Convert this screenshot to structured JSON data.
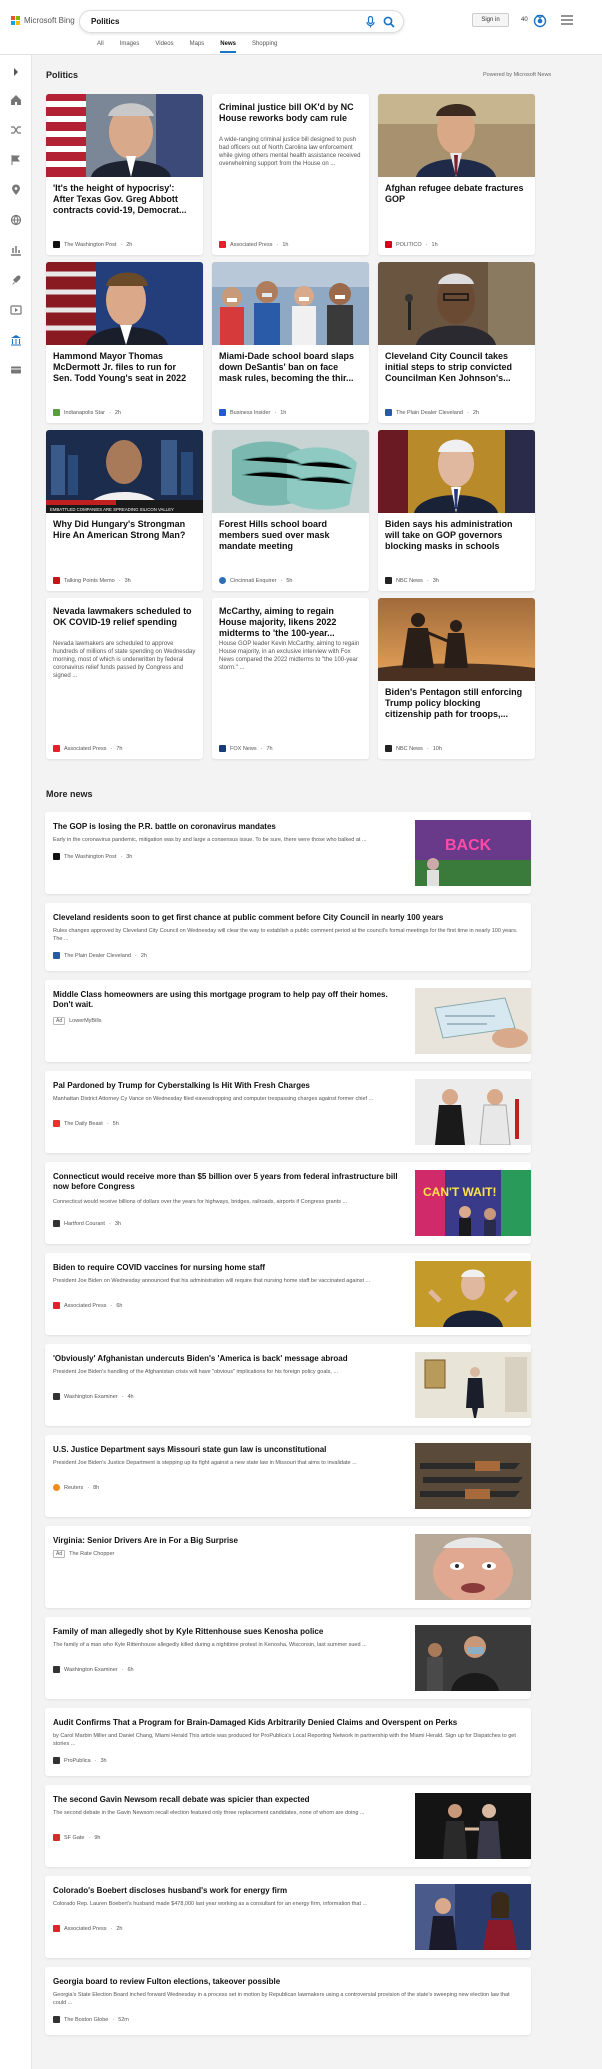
{
  "header": {
    "logo_text": "Microsoft Bing",
    "search_query": "Politics",
    "tabs": [
      "All",
      "Images",
      "Videos",
      "Maps",
      "News",
      "Shopping"
    ],
    "active_tab": "News",
    "signin": "Sign in",
    "points": "40"
  },
  "politics": {
    "title": "Politics",
    "powered": "Powered by Microsoft News",
    "cards": [
      {
        "title": "'It's the height of hypocrisy': After Texas Gov. Greg Abbott contracts covid-19, Democrat...",
        "source": "The Washington Post",
        "time": "2h",
        "logo_color": "#111"
      },
      {
        "title": "Criminal justice bill OK'd by NC House reworks body cam rule",
        "snippet": "A wide-ranging criminal justice bill designed to push bad officers out of North Carolina law enforcement while giving others mental health assistance received overwhelming support from the House on ...",
        "source": "Associated Press",
        "time": "1h",
        "logo_color": "#e4202d"
      },
      {
        "title": "Afghan refugee debate fractures GOP",
        "source": "POLITICO",
        "time": "1h",
        "logo_color": "#d6001c"
      },
      {
        "title": "Hammond Mayor Thomas McDermott Jr. files to run for Sen. Todd Young's seat in 2022",
        "source": "Indianapolis Star",
        "time": "2h",
        "logo_color": "#5a9e3a"
      },
      {
        "title": "Miami-Dade school board slaps down DeSantis' ban on face mask rules, becoming the thir...",
        "source": "Business Insider",
        "time": "1h",
        "logo_color": "#1d5cd6"
      },
      {
        "title": "Cleveland City Council takes initial steps to strip convicted Councilman Ken Johnson's...",
        "source": "The Plain Dealer Cleveland",
        "time": "2h",
        "logo_color": "#2a5aa6"
      },
      {
        "title": "Why Did Hungary's Strongman Hire An American Strong Man?",
        "source": "Talking Points Memo",
        "time": "3h",
        "logo_color": "#c4141b"
      },
      {
        "title": "Forest Hills school board members sued over mask mandate meeting",
        "source": "Cincinnati Enquirer",
        "time": "5h",
        "logo_color": "#2d6fb6"
      },
      {
        "title": "Biden says his administration will take on GOP governors blocking masks in schools",
        "source": "NBC News",
        "time": "3h",
        "logo_color": "#222"
      },
      {
        "title": "Nevada lawmakers scheduled to OK COVID-19 relief spending",
        "snippet": "Nevada lawmakers are scheduled to approve hundreds of millions of state spending on Wednesday morning, most of which is underwritten by federal coronavirus relief funds passed by Congress and signed ...",
        "source": "Associated Press",
        "time": "7h",
        "logo_color": "#e4202d"
      },
      {
        "title": "McCarthy, aiming to regain House majority, likens 2022 midterms to 'the 100-year...",
        "snippet": "House GOP leader Kevin McCarthy, aiming to regain House majority, in an exclusive interview with Fox News compared the 2022 midterms to \"the 100-year storm.\" ...",
        "source": "FOX News",
        "time": "7h",
        "logo_color": "#1a3a7a"
      },
      {
        "title": "Biden's Pentagon still enforcing Trump policy blocking citizenship path for troops,...",
        "source": "NBC News",
        "time": "10h",
        "logo_color": "#222"
      }
    ],
    "caption": "EMBATTLED COMPANIES ARE SPREADING SILICON VALLEY"
  },
  "more_news": {
    "title": "More news",
    "items": [
      {
        "title": "The GOP is losing the P.R. battle on coronavirus mandates",
        "snippet": "Early in the coronavirus pandemic, mitigation was by and large a consensus issue. To be sure, there were those who balked at ...",
        "source": "The Washington Post",
        "time": "3h",
        "logo_color": "#111",
        "img_text": "BACK"
      },
      {
        "title": "Cleveland residents soon to get first chance at public comment before City Council in nearly 100 years",
        "snippet": "Rules changes approved by Cleveland City Council on Wednesday will clear the way to establish a public comment period at the council's formal meetings for the first time in nearly 100 years. The ...",
        "source": "The Plain Dealer Cleveland",
        "time": "2h",
        "logo_color": "#2a5aa6"
      },
      {
        "title": "Middle Class homeowners are using this mortgage program to help pay off their homes. Don't wait.",
        "ad": "Ad",
        "source": "LowerMyBills"
      },
      {
        "title": "Pal Pardoned by Trump for Cyberstalking Is Hit With Fresh Charges",
        "snippet": "Manhattan District Attorney Cy Vance on Wednesday filed eavesdropping and computer trespassing charges against former chief ...",
        "source": "The Daily Beast",
        "time": "5h",
        "logo_color": "#e8322f"
      },
      {
        "title": "Connecticut would receive more than $5 billion over 5 years from federal infrastructure bill now before Congress",
        "snippet": "Connecticut would receive billions of dollars over the years for highways, bridges, railroads, airports if Congress grants ...",
        "source": "Hartford Courant",
        "time": "3h",
        "logo_color": "#333",
        "img_text": "CAN'T WAIT!"
      },
      {
        "title": "Biden to require COVID vaccines for nursing home staff",
        "snippet": "President Joe Biden on Wednesday announced that his administration will require that nursing home staff be vaccinated against ...",
        "source": "Associated Press",
        "time": "6h",
        "logo_color": "#e4202d"
      },
      {
        "title": "'Obviously' Afghanistan undercuts Biden's 'America is back' message abroad",
        "snippet": "President Joe Biden's handling of the Afghanistan crisis will have \"obvious\" implications for his foreign policy goals, ...",
        "source": "Washington Examiner",
        "time": "4h",
        "logo_color": "#333"
      },
      {
        "title": "U.S. Justice Department says Missouri state gun law is unconstitutional",
        "snippet": "President Joe Biden's Justice Department is stepping up its fight against a new state law in Missouri that aims to invalidate ...",
        "source": "Reuters",
        "time": "8h",
        "logo_color": "#f28a1e"
      },
      {
        "title": "Virginia: Senior Drivers Are in For a Big Surprise",
        "ad": "Ad",
        "source": "The Rate Chopper"
      },
      {
        "title": "Family of man allegedly shot by Kyle Rittenhouse sues Kenosha police",
        "snippet": "The family of a man who Kyle Rittenhouse allegedly killed during a nighttime protest in Kenosha, Wisconsin, last summer sued ...",
        "source": "Washington Examiner",
        "time": "6h",
        "logo_color": "#333"
      },
      {
        "title": "Audit Confirms That a Program for Brain-Damaged Kids Arbitrarily Denied Claims and Overspent on Perks",
        "snippet": "by Carol Marbin Miller and Daniel Chang, Miami Herald This article was produced for ProPublica's Local Reporting Network in partnership with the Miami Herald. Sign up for Dispatches to get stories ...",
        "source": "ProPublica",
        "time": "3h",
        "logo_color": "#333"
      },
      {
        "title": "The second Gavin Newsom recall debate was spicier than expected",
        "snippet": "The second debate in the Gavin Newsom recall election featured only three replacement candidates, none of whom are doing ...",
        "source": "SF Gate",
        "time": "9h",
        "logo_color": "#d32d2d"
      },
      {
        "title": "Colorado's Boebert discloses husband's work for energy firm",
        "snippet": "Colorado Rep. Lauren Boebert's husband made $478,000 last year working as a consultant for an energy firm, information that ...",
        "source": "Associated Press",
        "time": "2h",
        "logo_color": "#e4202d"
      },
      {
        "title": "Georgia board to review Fulton elections, takeover possible",
        "snippet": "Georgia's State Election Board inched forward Wednesday in a process set in motion by Republican lawmakers using a controversial provision of the state's sweeping new election law that could ...",
        "source": "The Boston Globe",
        "time": "52m",
        "logo_color": "#333"
      }
    ]
  }
}
